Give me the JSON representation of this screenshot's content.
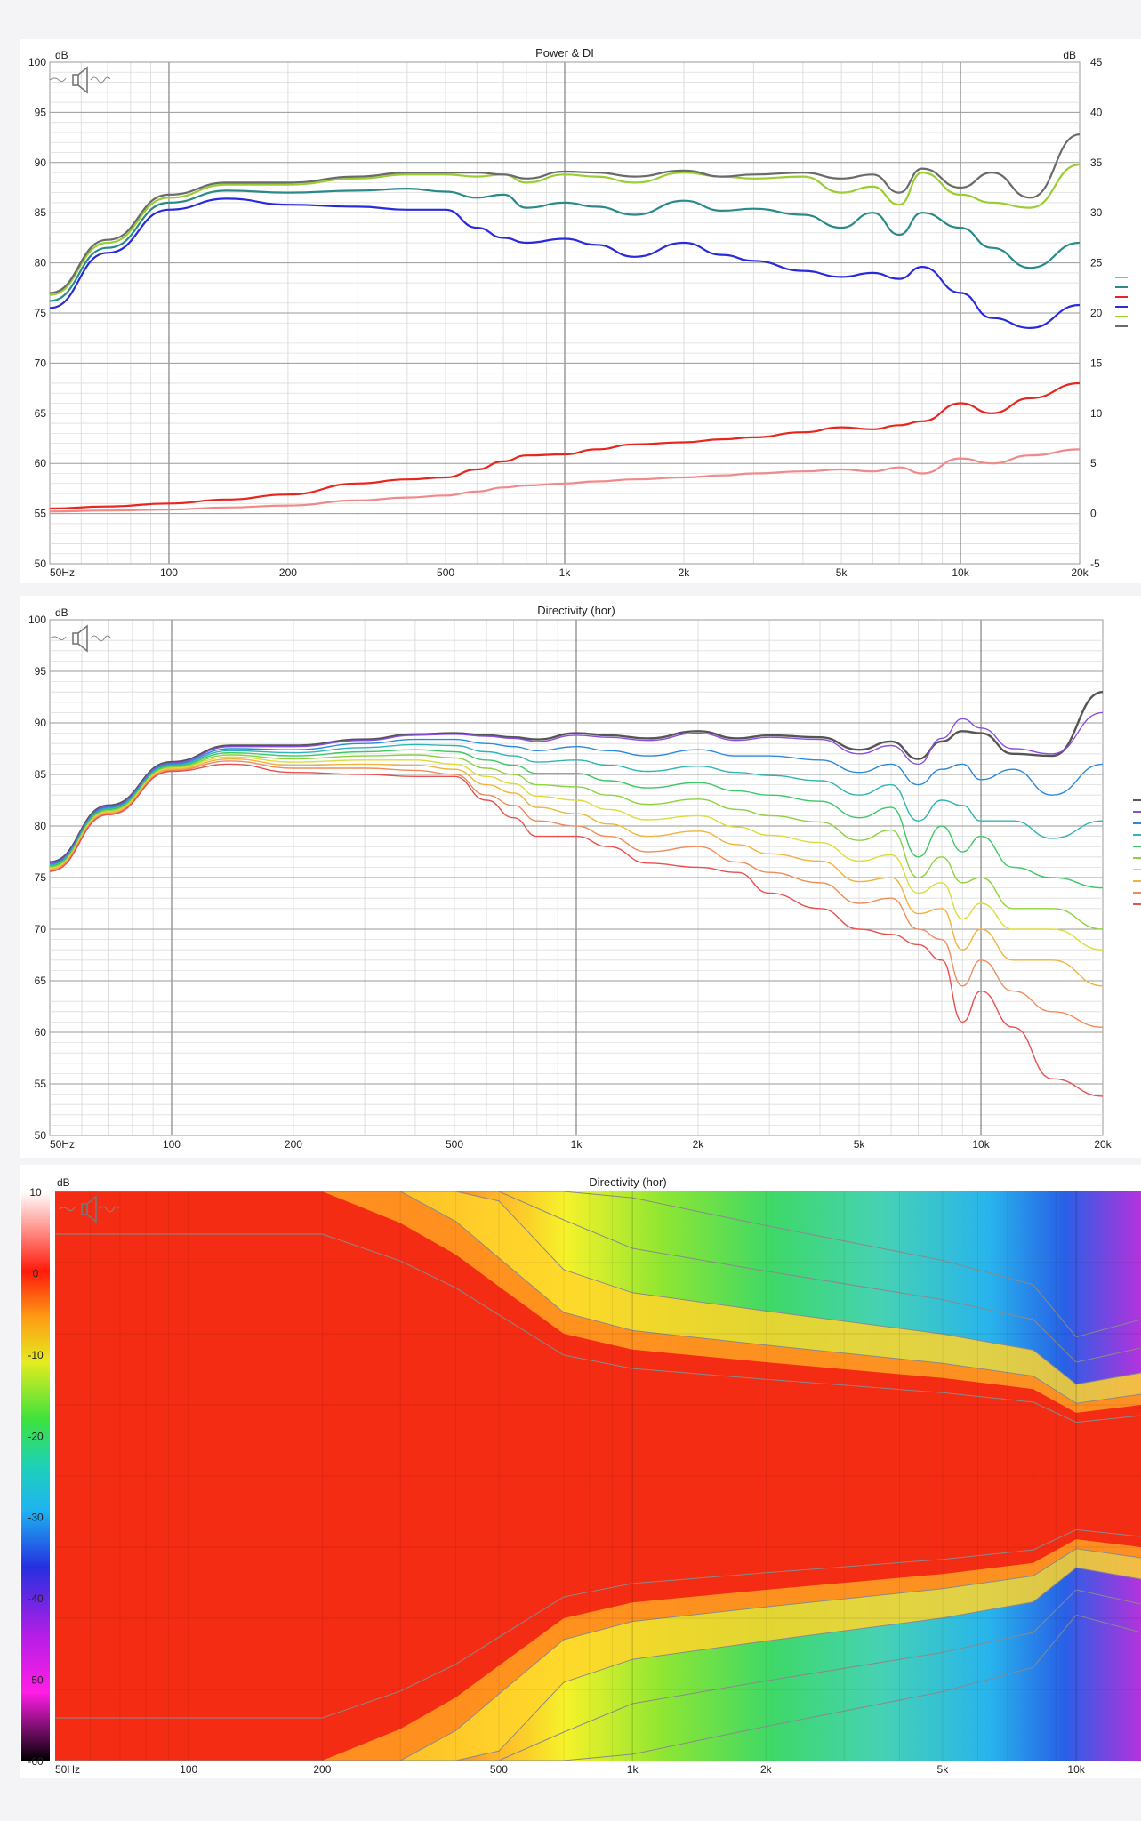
{
  "chart_data": [
    {
      "type": "line",
      "title": "Power & DI",
      "ylabel": "dB",
      "y2label": "dB",
      "xscale": "log",
      "xlim": [
        50,
        20000
      ],
      "ylim": [
        50,
        100
      ],
      "y2lim": [
        -5,
        45
      ],
      "grid": true,
      "legend": "right",
      "xtick_labels": [
        "50Hz",
        "100",
        "200",
        "500",
        "1k",
        "2k",
        "5k",
        "10k",
        "20k"
      ],
      "xtick_values": [
        50,
        100,
        200,
        500,
        1000,
        2000,
        5000,
        10000,
        20000
      ],
      "ytick_values": [
        50,
        55,
        60,
        65,
        70,
        75,
        80,
        85,
        90,
        95,
        100
      ],
      "y2tick_values": [
        -5,
        0,
        5,
        10,
        15,
        20,
        25,
        30,
        35,
        40,
        45
      ],
      "x": [
        50,
        70,
        100,
        140,
        200,
        300,
        400,
        500,
        600,
        700,
        800,
        1000,
        1200,
        1500,
        2000,
        2500,
        3000,
        4000,
        5000,
        6000,
        7000,
        8000,
        10000,
        12000,
        15000,
        20000
      ],
      "series": [
        {
          "color": "#f08a8a",
          "axis": "right",
          "values": [
            0.2,
            0.3,
            0.4,
            0.6,
            0.8,
            1.3,
            1.6,
            1.8,
            2.2,
            2.6,
            2.8,
            3.0,
            3.2,
            3.4,
            3.6,
            3.8,
            4.0,
            4.2,
            4.4,
            4.2,
            4.6,
            4.0,
            5.5,
            5.0,
            5.8,
            6.4
          ]
        },
        {
          "color": "#2a8a8a",
          "axis": "left",
          "values": [
            76.2,
            81.5,
            86.0,
            87.2,
            87.0,
            87.2,
            87.4,
            87.1,
            86.5,
            86.8,
            85.5,
            86.0,
            85.6,
            84.8,
            86.2,
            85.2,
            85.4,
            84.8,
            83.5,
            85.0,
            82.8,
            85.0,
            83.5,
            81.5,
            79.5,
            82.0
          ]
        },
        {
          "color": "#e8261e",
          "axis": "right",
          "values": [
            0.5,
            0.7,
            1.0,
            1.4,
            1.9,
            3.0,
            3.4,
            3.6,
            4.4,
            5.2,
            5.8,
            5.9,
            6.4,
            6.9,
            7.1,
            7.4,
            7.6,
            8.1,
            8.6,
            8.4,
            8.8,
            9.2,
            11.0,
            10.0,
            11.5,
            13.0
          ]
        },
        {
          "color": "#2a2add",
          "axis": "left",
          "values": [
            75.5,
            81.0,
            85.3,
            86.4,
            85.8,
            85.6,
            85.3,
            85.3,
            83.5,
            82.5,
            82.0,
            82.4,
            81.8,
            80.6,
            82.0,
            80.8,
            80.2,
            79.2,
            78.6,
            79.0,
            78.4,
            79.6,
            77.0,
            74.5,
            73.5,
            75.8
          ]
        },
        {
          "color": "#9acd32",
          "axis": "left",
          "values": [
            76.8,
            82.0,
            86.5,
            87.8,
            87.8,
            88.4,
            88.8,
            88.8,
            88.6,
            88.8,
            88.0,
            88.8,
            88.6,
            88.0,
            89.0,
            88.6,
            88.4,
            88.6,
            87.0,
            87.6,
            85.8,
            89.0,
            86.8,
            86.0,
            85.5,
            89.8
          ]
        },
        {
          "color": "#6a6a6a",
          "axis": "left",
          "values": [
            77.0,
            82.3,
            86.8,
            88.0,
            88.0,
            88.6,
            89.0,
            89.0,
            89.0,
            88.8,
            88.4,
            89.1,
            89.0,
            88.6,
            89.2,
            88.6,
            88.8,
            89.0,
            88.4,
            88.8,
            87.0,
            89.4,
            87.5,
            89.0,
            86.5,
            92.8
          ]
        }
      ]
    },
    {
      "type": "line",
      "title": "Directivity (hor)",
      "ylabel": "dB",
      "xscale": "log",
      "xlim": [
        50,
        20000
      ],
      "ylim": [
        50,
        100
      ],
      "grid": true,
      "legend": "right",
      "xtick_labels": [
        "50Hz",
        "100",
        "200",
        "500",
        "1k",
        "2k",
        "5k",
        "10k",
        "20k"
      ],
      "xtick_values": [
        50,
        100,
        200,
        500,
        1000,
        2000,
        5000,
        10000,
        20000
      ],
      "ytick_values": [
        50,
        55,
        60,
        65,
        70,
        75,
        80,
        85,
        90,
        95,
        100
      ],
      "x": [
        50,
        70,
        100,
        140,
        200,
        300,
        400,
        500,
        600,
        700,
        800,
        1000,
        1200,
        1500,
        2000,
        2500,
        3000,
        4000,
        5000,
        6000,
        7000,
        8000,
        9000,
        10000,
        12000,
        15000,
        20000
      ],
      "series": [
        {
          "color": "#555555",
          "width": 2.4,
          "values": [
            76.5,
            82.0,
            86.2,
            87.8,
            87.8,
            88.4,
            88.9,
            89.0,
            88.8,
            88.6,
            88.4,
            89.0,
            88.8,
            88.5,
            89.2,
            88.5,
            88.8,
            88.6,
            87.4,
            88.2,
            86.5,
            88.2,
            89.2,
            89.0,
            87.0,
            86.8,
            93.0
          ]
        },
        {
          "color": "#8a4fe0",
          "values": [
            76.4,
            81.9,
            86.1,
            87.7,
            87.7,
            88.3,
            88.8,
            88.9,
            88.7,
            88.5,
            88.2,
            88.8,
            88.6,
            88.3,
            89.0,
            88.3,
            88.6,
            88.4,
            87.0,
            87.8,
            86.0,
            88.5,
            90.4,
            89.5,
            87.5,
            87.0,
            91.0
          ]
        },
        {
          "color": "#2a8adc",
          "values": [
            76.3,
            81.8,
            86.0,
            87.5,
            87.4,
            88.0,
            88.4,
            88.4,
            88.0,
            87.7,
            87.3,
            87.7,
            87.3,
            86.8,
            87.4,
            86.8,
            86.8,
            86.4,
            85.2,
            86.0,
            84.0,
            85.5,
            86.0,
            84.5,
            85.5,
            83.0,
            86.0
          ]
        },
        {
          "color": "#30b4b4",
          "values": [
            76.2,
            81.7,
            85.9,
            87.3,
            87.1,
            87.6,
            87.9,
            87.8,
            87.2,
            86.8,
            86.2,
            86.4,
            85.9,
            85.3,
            85.8,
            85.2,
            84.9,
            84.4,
            83.0,
            84.0,
            80.5,
            82.5,
            82.0,
            80.5,
            80.5,
            78.8,
            80.5
          ]
        },
        {
          "color": "#3cc864",
          "values": [
            76.1,
            81.6,
            85.8,
            87.1,
            86.8,
            87.2,
            87.4,
            87.2,
            86.4,
            85.9,
            85.1,
            85.1,
            84.4,
            83.7,
            84.2,
            83.4,
            83.0,
            82.4,
            80.8,
            81.8,
            77.0,
            80.0,
            77.5,
            79.0,
            76.0,
            75.0,
            74.0
          ]
        },
        {
          "color": "#8cd23c",
          "values": [
            76.0,
            81.5,
            85.7,
            86.9,
            86.5,
            86.8,
            86.9,
            86.6,
            85.6,
            85.0,
            84.0,
            83.8,
            83.0,
            82.1,
            82.6,
            81.6,
            81.0,
            80.4,
            78.6,
            79.6,
            75.0,
            77.0,
            74.5,
            75.0,
            72.0,
            72.0,
            70.0
          ]
        },
        {
          "color": "#dcdc3c",
          "values": [
            75.9,
            81.4,
            85.6,
            86.7,
            86.2,
            86.4,
            86.4,
            86.0,
            84.8,
            84.1,
            82.9,
            82.5,
            81.6,
            80.6,
            81.0,
            79.9,
            79.1,
            78.4,
            76.6,
            77.2,
            73.5,
            74.5,
            71.0,
            72.5,
            70.0,
            70.0,
            68.0
          ]
        },
        {
          "color": "#f0b43c",
          "values": [
            75.8,
            81.3,
            85.5,
            86.5,
            85.9,
            86.0,
            85.9,
            85.5,
            84.0,
            83.2,
            81.8,
            81.2,
            80.2,
            79.0,
            79.5,
            78.2,
            77.3,
            76.6,
            74.6,
            75.0,
            71.5,
            72.0,
            68.0,
            70.0,
            67.0,
            67.0,
            64.5
          ]
        },
        {
          "color": "#f08c5a",
          "values": [
            75.7,
            81.2,
            85.4,
            86.3,
            85.6,
            85.6,
            85.4,
            85.0,
            83.0,
            82.0,
            80.5,
            80.0,
            79.0,
            77.5,
            78.0,
            76.5,
            75.5,
            74.5,
            72.5,
            73.0,
            70.0,
            69.0,
            64.5,
            67.0,
            64.0,
            62.0,
            60.5
          ]
        },
        {
          "color": "#e85050",
          "values": [
            75.6,
            81.1,
            85.3,
            86.0,
            85.2,
            85.0,
            84.8,
            84.8,
            82.5,
            80.8,
            79.0,
            79.0,
            78.0,
            76.4,
            76.0,
            75.5,
            73.5,
            72.0,
            70.0,
            69.5,
            68.5,
            67.0,
            61.0,
            64.0,
            60.5,
            55.5,
            53.8
          ]
        }
      ]
    },
    {
      "type": "heatmap",
      "title": "Directivity (hor)",
      "ylabel": "dB",
      "xscale": "log",
      "xlim": [
        50,
        14000
      ],
      "colorbar_range": [
        -60,
        10
      ],
      "colorbar_ticks": [
        "10",
        "0",
        "-10",
        "-20",
        "-30",
        "-40",
        "-50",
        "-60"
      ],
      "xtick_labels": [
        "50Hz",
        "100",
        "200",
        "500",
        "1k",
        "2k",
        "5k",
        "10k"
      ],
      "xtick_values": [
        50,
        100,
        200,
        500,
        1000,
        2000,
        5000,
        10000
      ],
      "angle_range_deg": [
        -180,
        180
      ],
      "beamwidth_x": [
        50,
        200,
        300,
        400,
        500,
        700,
        1000,
        2000,
        5000,
        8000,
        10000,
        14000
      ],
      "beamwidth_6dB_deg": [
        180,
        180,
        160,
        140,
        120,
        90,
        80,
        72,
        62,
        55,
        40,
        45
      ]
    }
  ]
}
